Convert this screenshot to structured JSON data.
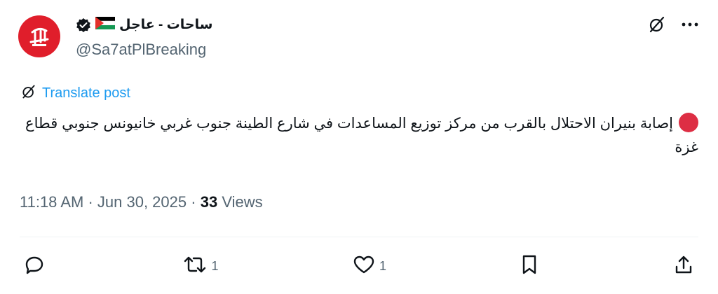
{
  "author": {
    "display_name": "ساحات - عاجل",
    "handle": "@Sa7atPlBreaking",
    "avatar_icon": "avatar-logo",
    "badge_icon": "verified-badge-icon",
    "flag_icon": "palestine-flag-icon"
  },
  "top_actions": {
    "grok_icon": "grok-icon",
    "more_icon": "more-icon"
  },
  "translate": {
    "label": "Translate post"
  },
  "post": {
    "emoji": "red-circle",
    "text": "إصابة بنيران الاحتلال بالقرب من مركز توزيع المساعدات في شارع الطينة جنوب غربي خانيونس جنوبي قطاع غزة"
  },
  "meta": {
    "time": "11:18 AM",
    "sep1": "·",
    "date": "Jun 30, 2025",
    "sep2": "·",
    "views_count": "33",
    "views_label": "Views"
  },
  "actions": {
    "reply": {
      "icon": "reply-icon",
      "count": ""
    },
    "repost": {
      "icon": "repost-icon",
      "count": "1"
    },
    "like": {
      "icon": "like-icon",
      "count": "1"
    },
    "bookmark": {
      "icon": "bookmark-icon",
      "count": ""
    },
    "share": {
      "icon": "share-icon",
      "count": ""
    }
  },
  "colors": {
    "link": "#1d9bf0",
    "secondary_text": "#536471",
    "primary_text": "#0f1419",
    "avatar_bg": "#e01e2b",
    "emoji_red": "#dd2e44"
  }
}
